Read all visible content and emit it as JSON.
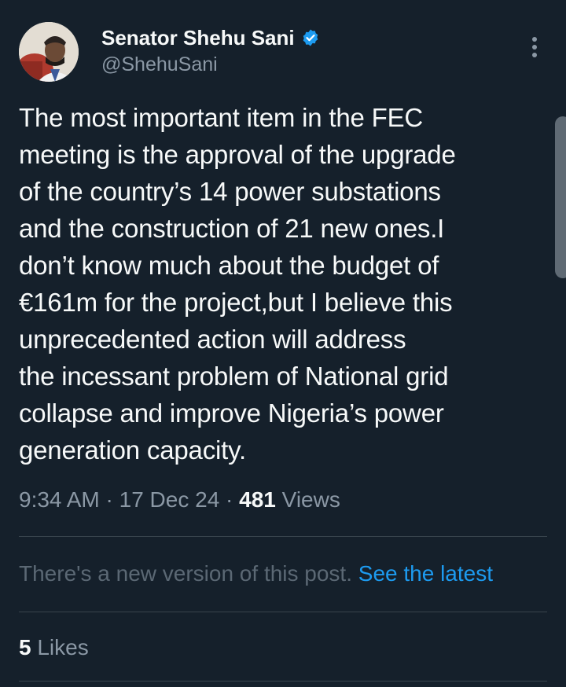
{
  "author": {
    "display_name": "Senator Shehu Sani",
    "handle": "@ShehuSani"
  },
  "tweet": {
    "text": "The most important item in the FEC\nmeeting is the approval of the upgrade\nof the country’s 14 power substations\nand the construction of 21 new ones.I\ndon’t know much about the budget of\n€161m for the project,but I believe this\nunprecedented action will address\nthe incessant problem of National grid\ncollapse and improve Nigeria’s power\ngeneration capacity."
  },
  "meta": {
    "time": "9:34 AM",
    "separator": " · ",
    "date": "17 Dec 24",
    "views_count": "481",
    "views_label": " Views"
  },
  "notice": {
    "text": "There's a new version of this post. ",
    "link": "See the latest"
  },
  "engagement": {
    "likes_count": "5",
    "likes_label": " Likes"
  },
  "colors": {
    "background": "#15202b",
    "accent": "#1d9bf0",
    "secondary_text": "#8b98a5"
  },
  "icons": {
    "verified": "verified-badge-icon",
    "more": "more-options-icon"
  }
}
